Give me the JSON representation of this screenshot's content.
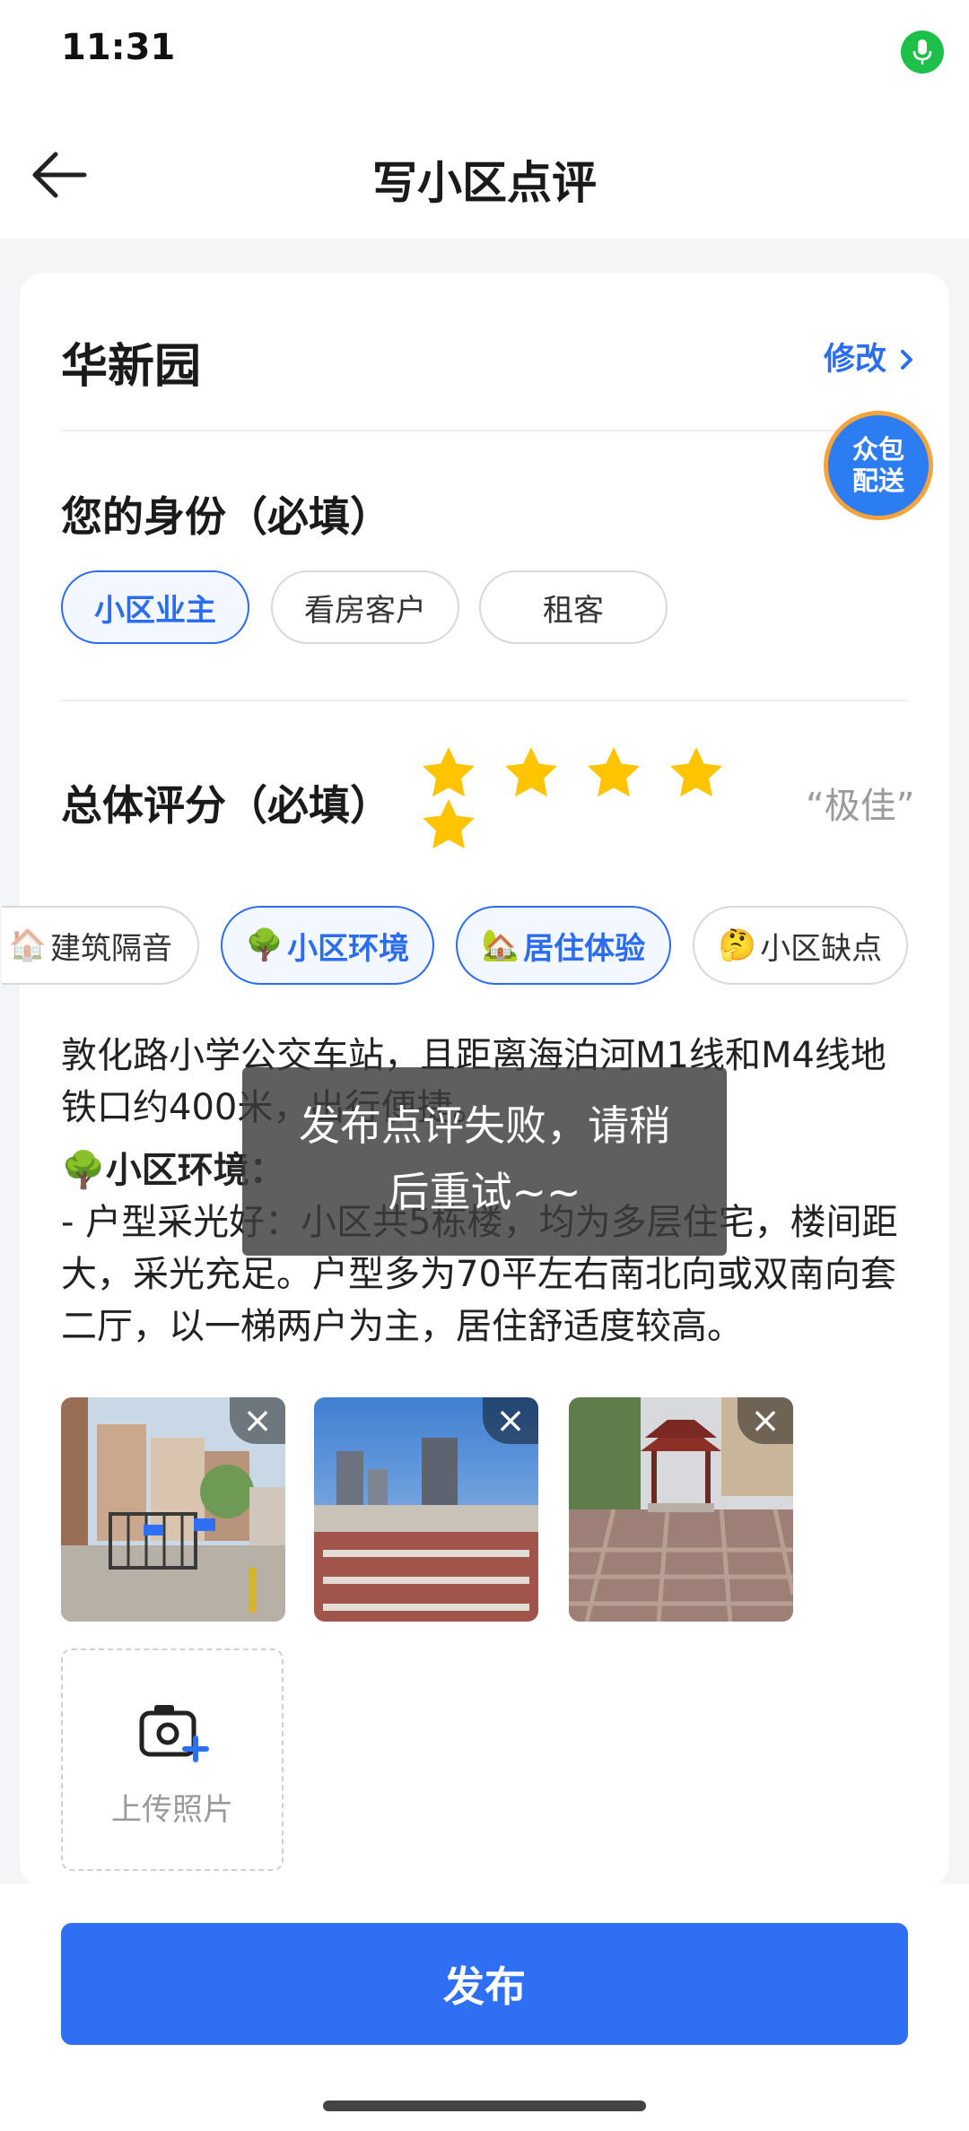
{
  "status_bar": {
    "time": "11:31"
  },
  "nav": {
    "title": "写小区点评"
  },
  "community": {
    "name": "华新园",
    "edit_label": "修改"
  },
  "float_badge": {
    "line1": "众包",
    "line2": "配送"
  },
  "identity": {
    "title": "您的身份（必填）",
    "options": [
      {
        "label": "小区业主",
        "selected": true
      },
      {
        "label": "看房客户",
        "selected": false
      },
      {
        "label": "租客",
        "selected": false
      }
    ]
  },
  "rating": {
    "title": "总体评分（必填）",
    "stars": 5,
    "max_stars": 5,
    "label": "“极佳”",
    "star_color": "#ffc400"
  },
  "tags": [
    {
      "emoji": "🏠",
      "label": "建筑隔音",
      "selected": false
    },
    {
      "emoji": "🌳",
      "label": "小区环境",
      "selected": true
    },
    {
      "emoji": "🏡",
      "label": "居住体验",
      "selected": true
    },
    {
      "emoji": "🤔",
      "label": "小区缺点",
      "selected": false
    }
  ],
  "review": {
    "paragraph1": "敦化路小学公交车站，且距离海泊河M1线和M4线地铁口约400米，出行便捷。",
    "heading_emoji": "🌳",
    "heading": "小区环境：",
    "paragraph2": "- 户型采光好：小区共5栋楼，均为多层住宅，楼间距大，采光充足。户型多为70平左右南北向或双南向套二厅，以一梯两户为主，居住舒适度较高。"
  },
  "photos": [
    {
      "name": "community-gate-photo",
      "remove_icon": "×"
    },
    {
      "name": "building-skyline-photo",
      "remove_icon": "×"
    },
    {
      "name": "pavilion-plaza-photo",
      "remove_icon": "×"
    }
  ],
  "upload": {
    "label": "上传照片"
  },
  "toast": {
    "line1": "发布点评失败，请稍",
    "line2": "后重试~~"
  },
  "publish_button": {
    "label": "发布"
  },
  "colors": {
    "accent": "#2f6ff3",
    "link": "#2b6cf0",
    "mic": "#1ec04a"
  }
}
